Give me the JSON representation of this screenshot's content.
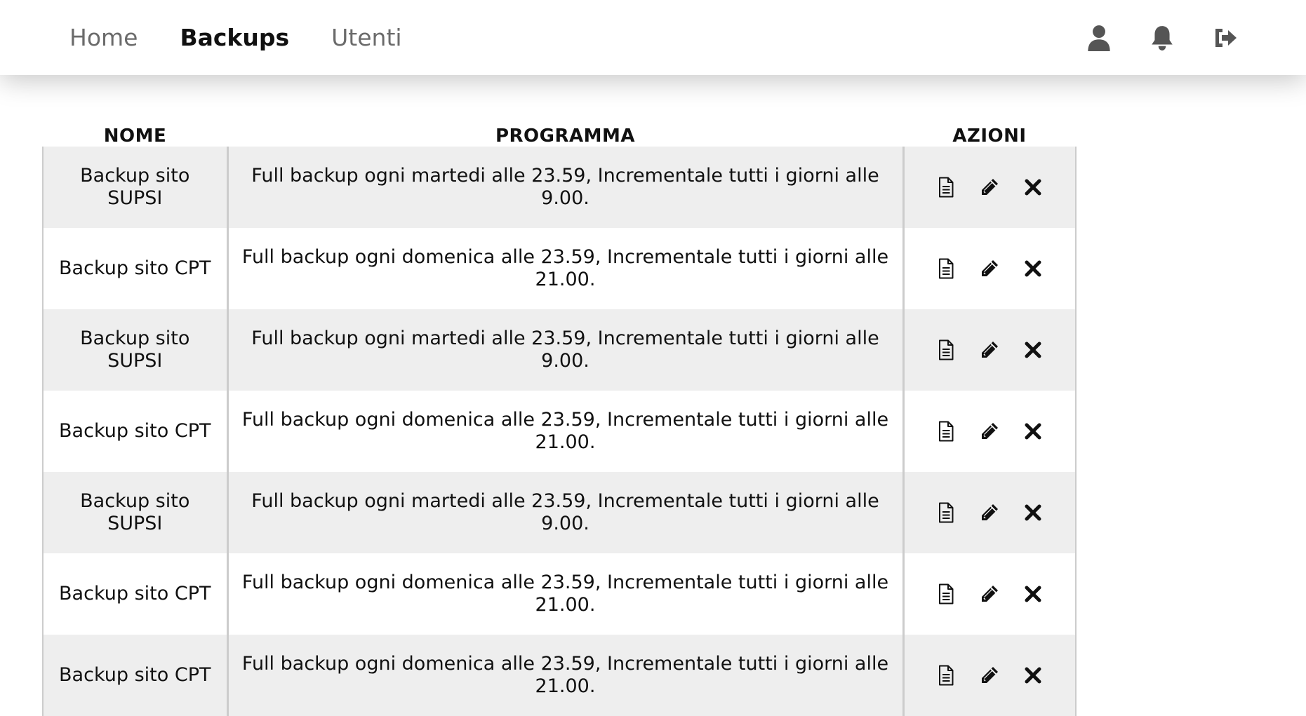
{
  "nav": {
    "links": [
      {
        "label": "Home",
        "active": false
      },
      {
        "label": "Backups",
        "active": true
      },
      {
        "label": "Utenti",
        "active": false
      }
    ],
    "icons": [
      "user-icon",
      "bell-icon",
      "logout-icon"
    ]
  },
  "table": {
    "headers": {
      "name": "NOME",
      "program": "PROGRAMMA",
      "actions": "AZIONI"
    },
    "rows": [
      {
        "name": "Backup sito SUPSI",
        "program": "Full backup ogni martedi alle 23.59, Incrementale tutti i giorni alle 9.00."
      },
      {
        "name": "Backup sito CPT",
        "program": "Full backup ogni domenica alle 23.59, Incrementale tutti i giorni alle 21.00."
      },
      {
        "name": "Backup sito SUPSI",
        "program": "Full backup ogni martedi alle 23.59, Incrementale tutti i giorni alle 9.00."
      },
      {
        "name": "Backup sito CPT",
        "program": "Full backup ogni domenica alle 23.59, Incrementale tutti i giorni alle 21.00."
      },
      {
        "name": "Backup sito SUPSI",
        "program": "Full backup ogni martedi alle 23.59, Incrementale tutti i giorni alle 9.00."
      },
      {
        "name": "Backup sito CPT",
        "program": "Full backup ogni domenica alle 23.59, Incrementale tutti i giorni alle 21.00."
      },
      {
        "name": "Backup sito CPT",
        "program": "Full backup ogni domenica alle 23.59, Incrementale tutti i giorni alle 21.00."
      }
    ],
    "row_actions": [
      "document-icon",
      "pencil-icon",
      "close-icon"
    ]
  },
  "colors": {
    "row_shade": "#eeeeee",
    "border": "#cccccc",
    "nav_inactive": "#6b6b6b",
    "nav_icon": "#555555"
  }
}
